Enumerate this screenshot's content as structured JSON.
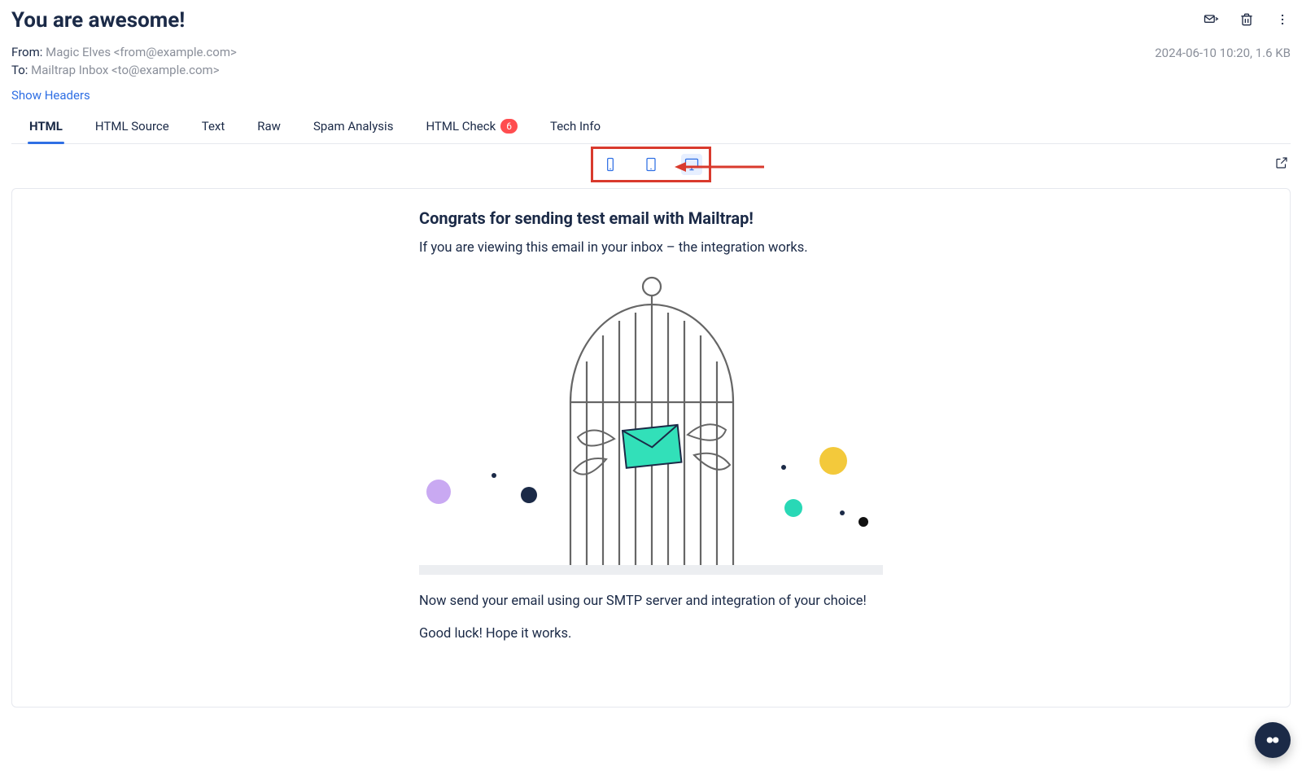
{
  "email": {
    "subject": "You are awesome!",
    "from_label": "From:",
    "from_value": "Magic Elves <from@example.com>",
    "to_label": "To:",
    "to_value": "Mailtrap Inbox <to@example.com>",
    "timestamp": "2024-06-10 10:20,",
    "size": "1.6 KB",
    "show_headers": "Show Headers"
  },
  "tabs": {
    "html": "HTML",
    "html_source": "HTML Source",
    "text": "Text",
    "raw": "Raw",
    "spam_analysis": "Spam Analysis",
    "html_check": "HTML Check",
    "html_check_badge": "6",
    "tech_info": "Tech Info"
  },
  "body": {
    "heading": "Congrats for sending test email with Mailtrap!",
    "line1": "If you are viewing this email in your inbox – the integration works.",
    "line2": "Now send your email using our SMTP server and integration of your choice!",
    "line3": "Good luck! Hope it works."
  },
  "icons": {
    "mark_open": "mark-open-icon",
    "delete": "trash-icon",
    "more": "more-vertical-icon",
    "mobile": "mobile-icon",
    "tablet": "tablet-icon",
    "desktop": "desktop-icon",
    "external": "external-link-icon",
    "help": "help-widget-icon"
  }
}
